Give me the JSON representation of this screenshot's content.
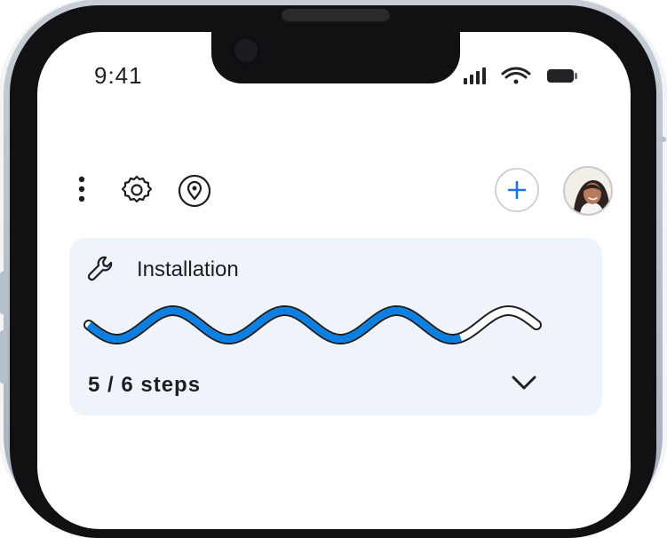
{
  "status_bar": {
    "time": "9:41"
  },
  "icons": {
    "more": "more-vertical-icon",
    "settings": "gear-icon",
    "location": "location-pin-icon",
    "add": "plus-icon",
    "tool": "wrench-icon",
    "expand": "chevron-down-icon"
  },
  "installation": {
    "title": "Installation",
    "steps_label": "5 / 6 steps",
    "progress": 0.83
  },
  "colors": {
    "progress_blue": "#0b7fe2",
    "card_bg": "#eff4fb",
    "accent": "#1a73e8"
  }
}
